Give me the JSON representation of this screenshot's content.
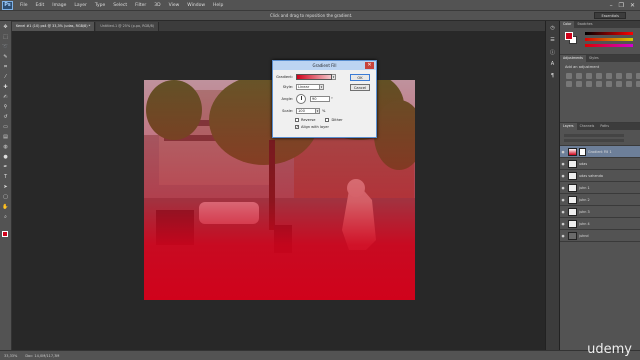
{
  "menu": {
    "logo": "Ps",
    "items": [
      "File",
      "Edit",
      "Image",
      "Layer",
      "Type",
      "Select",
      "Filter",
      "3D",
      "View",
      "Window",
      "Help"
    ],
    "window_controls": [
      "–",
      "❐",
      "✕"
    ]
  },
  "options_bar": {
    "hint": "Click and drag to reposition the gradient.",
    "workspace": "Essentials"
  },
  "tabs": [
    {
      "label": "Kenel #1 (10) ps4 @ 33,3% (udas, RGB/8) *",
      "active": true
    },
    {
      "label": "Untitled-1 @ 25% (p.po, RGB/8)",
      "active": false
    }
  ],
  "status": {
    "zoom": "33,33%",
    "doc": "Doc: 14,0M/117,3M"
  },
  "dialog": {
    "title": "Gradient Fill",
    "close": "✕",
    "gradient_label": "Gradient:",
    "style_label": "Style:",
    "style_value": "Linear",
    "angle_label": "Angle:",
    "angle_value": "90",
    "angle_unit": "°",
    "scale_label": "Scale:",
    "scale_value": "100",
    "scale_unit": "%",
    "reverse_label": "Reverse",
    "dither_label": "Dither",
    "align_label": "Align with layer",
    "ok_label": "OK",
    "cancel_label": "Cancel",
    "reverse_checked": false,
    "dither_checked": false,
    "align_checked": true
  },
  "panels": {
    "color_tabs": [
      "Color",
      "Swatches"
    ],
    "adjust_tabs": [
      "Adjustments",
      "Styles"
    ],
    "adjust_title": "Add an adjustment",
    "layers_tabs": [
      "Layers",
      "Channels",
      "Paths"
    ],
    "layers": [
      {
        "name": "Gradient Fill 1",
        "selected": true
      },
      {
        "name": "udas",
        "selected": false
      },
      {
        "name": "udas vahenda",
        "selected": false
      },
      {
        "name": "juhn 1",
        "selected": false
      },
      {
        "name": "juhn 2",
        "selected": false
      },
      {
        "name": "juhn 3",
        "selected": false
      },
      {
        "name": "juhn 4",
        "selected": false
      },
      {
        "name": "juhnd",
        "selected": false
      }
    ]
  },
  "watermark": "udemy",
  "colors": {
    "foreground": "#d0021b",
    "background": "#ffffff",
    "accent": "#6d7f99"
  }
}
